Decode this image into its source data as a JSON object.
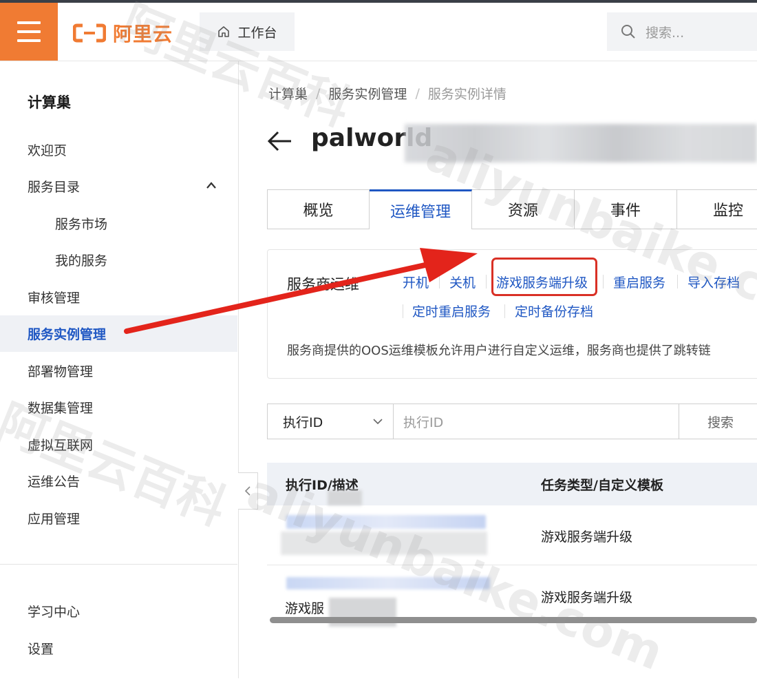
{
  "topbar": {
    "logo_text": "阿里云",
    "workbench_label": "工作台",
    "search_placeholder": "搜索..."
  },
  "sidebar": {
    "title": "计算巢",
    "items": [
      {
        "label": "欢迎页"
      },
      {
        "label": "服务目录"
      },
      {
        "label": "服务市场"
      },
      {
        "label": "我的服务"
      },
      {
        "label": "审核管理"
      },
      {
        "label": "服务实例管理"
      },
      {
        "label": "部署物管理"
      },
      {
        "label": "数据集管理"
      },
      {
        "label": "虚拟互联网"
      },
      {
        "label": "运维公告"
      },
      {
        "label": "应用管理"
      }
    ],
    "bottom_items": [
      {
        "label": "学习中心"
      },
      {
        "label": "设置"
      }
    ]
  },
  "breadcrumb": [
    "计算巢",
    "服务实例管理",
    "服务实例详情"
  ],
  "page": {
    "title": "palworld"
  },
  "tabs": [
    "概览",
    "运维管理",
    "资源",
    "事件",
    "监控"
  ],
  "ops": {
    "label": "服务商运维",
    "actions": [
      "开机",
      "关机",
      "游戏服务端升级",
      "重启服务",
      "导入存档",
      "定时重启服务",
      "定时备份存档"
    ],
    "description": "服务商提供的OOS运维模板允许用户进行自定义运维，服务商也提供了跳转链"
  },
  "filter": {
    "select_value": "执行ID",
    "input_placeholder": "执行ID",
    "search_label": "搜索"
  },
  "table": {
    "columns": [
      "执行ID/描述",
      "任务类型/自定义模板"
    ],
    "rows": [
      {
        "desc": "",
        "type": "游戏服务端升级"
      },
      {
        "desc": "游戏服",
        "type": "游戏服务端升级"
      }
    ]
  },
  "watermark": [
    "阿里云百科",
    "aliyunbaike.com"
  ],
  "colors": {
    "brand_orange": "#f07b33",
    "link_blue": "#1f57c3",
    "annotation_red": "#e3241b"
  }
}
